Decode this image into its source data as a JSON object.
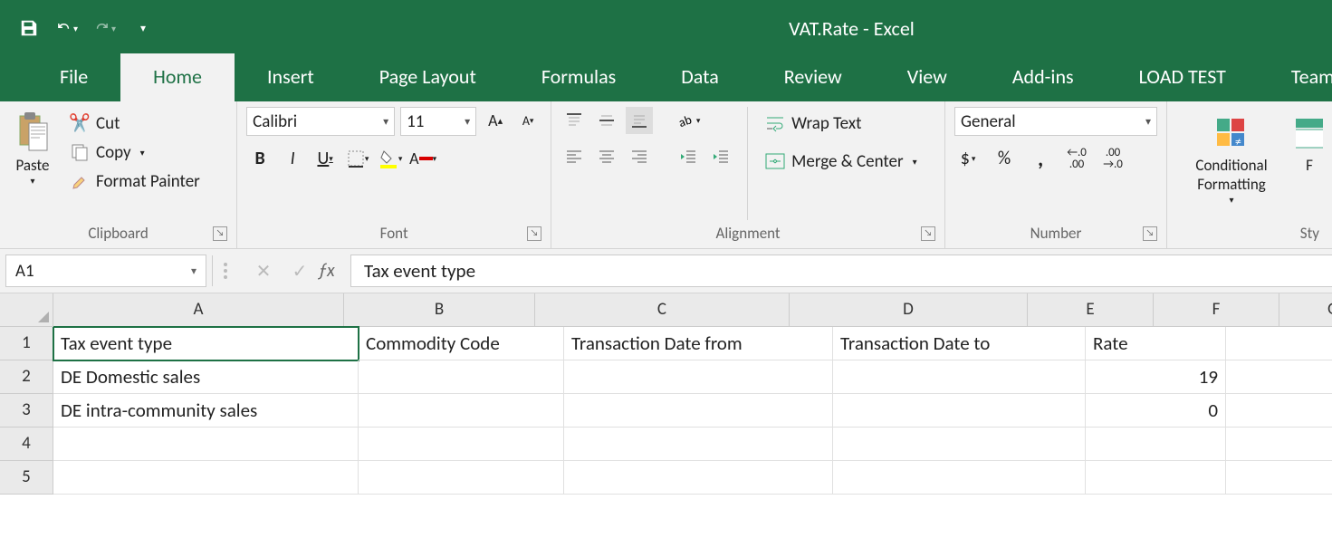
{
  "title": "VAT.Rate - Excel",
  "tabs": [
    "File",
    "Home",
    "Insert",
    "Page Layout",
    "Formulas",
    "Data",
    "Review",
    "View",
    "Add-ins",
    "LOAD TEST",
    "Team"
  ],
  "activeTab": "Home",
  "clipboard": {
    "paste": "Paste",
    "cut": "Cut",
    "copy": "Copy",
    "painter": "Format Painter",
    "label": "Clipboard"
  },
  "font": {
    "name": "Calibri",
    "size": "11",
    "label": "Font"
  },
  "alignment": {
    "wrap": "Wrap Text",
    "merge": "Merge & Center",
    "label": "Alignment"
  },
  "number": {
    "format": "General",
    "label": "Number"
  },
  "styles": {
    "cond": "Conditional Formatting",
    "fmt": "F",
    "label": "Sty"
  },
  "namebox": "A1",
  "formula": "Tax event type",
  "columns": [
    "A",
    "B",
    "C",
    "D",
    "E",
    "F",
    "G"
  ],
  "rows": [
    "1",
    "2",
    "3",
    "4",
    "5"
  ],
  "data": {
    "r1": {
      "A": "Tax event type",
      "B": "Commodity Code",
      "C": "Transaction Date from",
      "D": "Transaction Date to",
      "E": "Rate"
    },
    "r2": {
      "A": "DE Domestic sales",
      "E": "19"
    },
    "r3": {
      "A": "DE intra-community sales",
      "E": "0"
    }
  }
}
